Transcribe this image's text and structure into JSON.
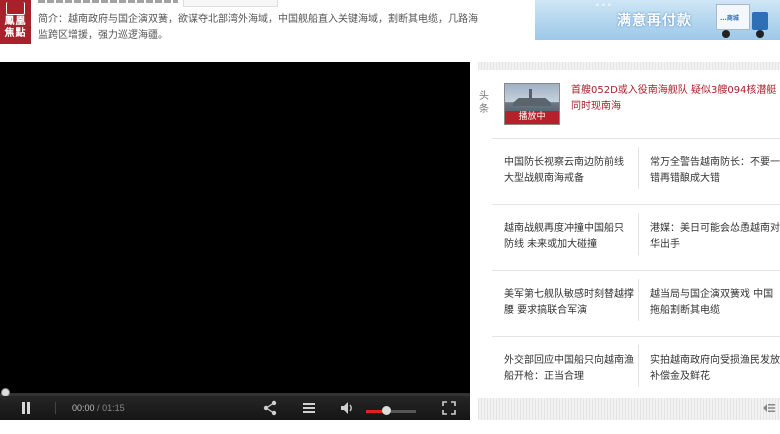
{
  "brand": {
    "logo_text": "鳳凰\n焦點"
  },
  "summary": "简介：越南政府与国企演双簧，欲谋夺北部湾外海域，中国舰船直入关键海域，割断其电缆，几路海监跨区增援，强力巡逻海疆。",
  "ad": {
    "headline": "...",
    "line": "满意再付款",
    "truck_label": "...商城"
  },
  "player": {
    "current_time": "00:00",
    "separator": "/",
    "duration": "01:15",
    "progress": 0,
    "volume": 0.4
  },
  "panel": {
    "side_label": "头\n条",
    "headline": {
      "thumb_label": "播放中",
      "text": "首艘052D或入役南海舰队 疑似3艘094核潜艇同时现南海"
    },
    "rows": [
      {
        "left": "中国防长视察云南边防前线 大型战舰南海戒备",
        "right": "常万全警告越南防长：不要一错再错酿成大错"
      },
      {
        "left": "越南战舰再度冲撞中国船只 防线 未来或加大碰撞",
        "right": "港媒：美日可能会怂恿越南对华出手"
      },
      {
        "left": "美军第七舰队敏感时刻替越撑腰 要求搞联合军演",
        "right": "越当局与国企演双簧戏 中国拖船割断其电缆"
      },
      {
        "left": "外交部回应中国船只向越南渔船开枪：正当合理",
        "right": "实拍越南政府向受损渔民发放补偿金及鲜花"
      }
    ]
  }
}
